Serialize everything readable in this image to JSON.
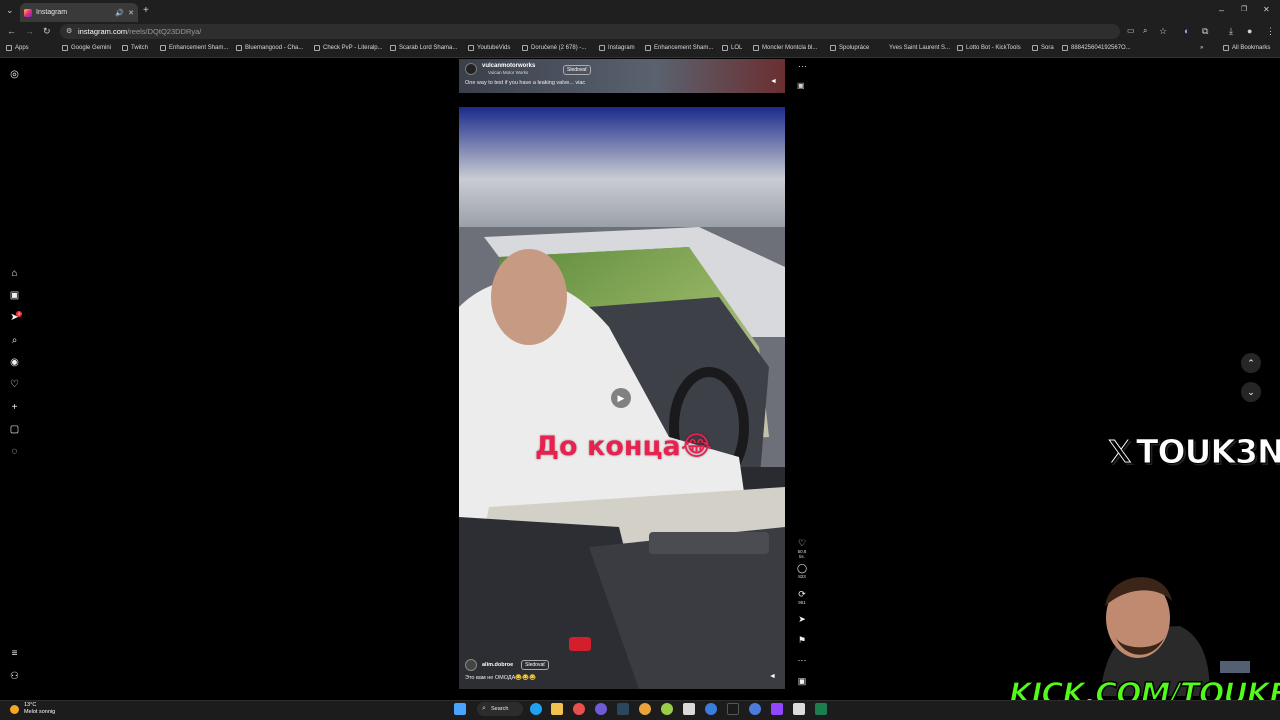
{
  "browser": {
    "tab_title": "Instagram",
    "url_host": "instagram.com",
    "url_path": "/reels/DQtQ23DDRya/",
    "bookmarks": [
      "Apps",
      "Google Gemini",
      "Twitch",
      "Enhancement Sham...",
      "Bluemangood - Cha...",
      "Check PvP - Literalp...",
      "Scarab Lord Shama...",
      "YoutubeVids",
      "Doručené (2 678) -...",
      "Instagram",
      "Enhancement Sham...",
      "LOL",
      "Moncler Montcla bl...",
      "Spolupráce",
      "Yves Saint Laurent S...",
      "Lotto Bot - KickTools",
      "Sora",
      "888425604192567O...",
      "All Bookmarks"
    ]
  },
  "sidebar": {
    "notification_badge": "4"
  },
  "reel_top": {
    "account": "vulcanmotorworks",
    "subtitle": "Vulcan Motor Works",
    "follow_label": "Sledovať",
    "caption": "One way to test if you have a leaking valve... viac"
  },
  "reel": {
    "overlay_text": "До конца😂",
    "author": "alim.dobroe",
    "follow_label": "Sledovať",
    "caption": "Это вам не ОМОДА😂😂😂",
    "likes": "50,8 tis.",
    "comments": "823",
    "reposts": "951"
  },
  "overlays": {
    "x_handle": "TOUK3N",
    "kick_url": "KICK.COM/TOUKEN"
  },
  "taskbar": {
    "temperature": "13°C",
    "weather_desc": "Melot sonnig",
    "search_label": "Search"
  },
  "colors": {
    "overlay_text": "#e8214f",
    "kick_green": "#53fc18",
    "badge_red": "#ff3040"
  }
}
